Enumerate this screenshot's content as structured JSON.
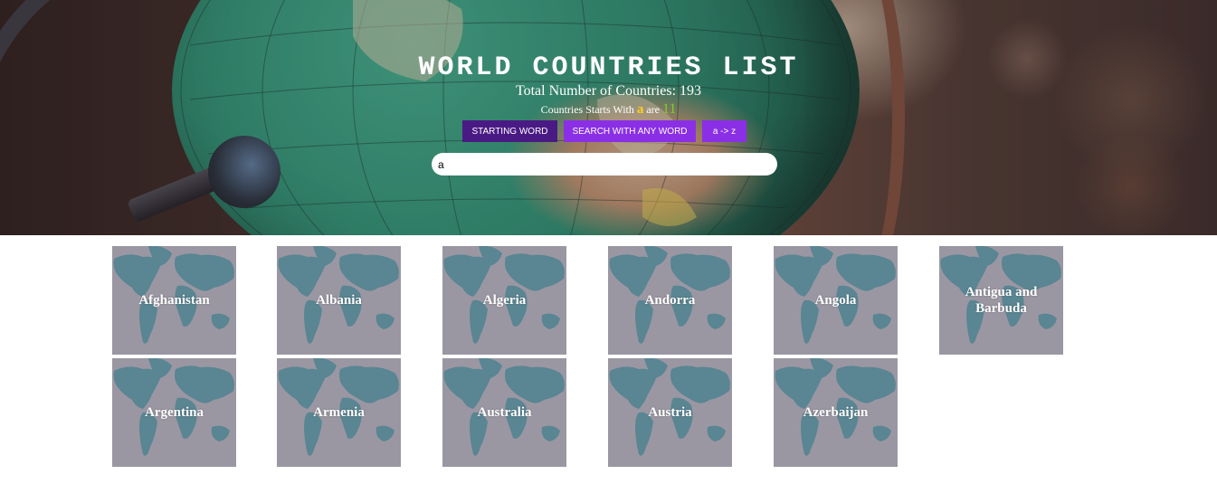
{
  "header": {
    "title": "WORLD COUNTRIES LIST",
    "total_prefix": "Total Number of Countries:",
    "total_count": "193",
    "starts_prefix": "Countries Starts With",
    "starts_letter": "a",
    "starts_are": "are",
    "starts_count": "11"
  },
  "buttons": {
    "starting_word": "STARTING WORD",
    "search_any": "SEARCH WITH ANY WORD",
    "sort": "a -> z"
  },
  "search": {
    "value": "a",
    "placeholder": ""
  },
  "countries": [
    "Afghanistan",
    "Albania",
    "Algeria",
    "Andorra",
    "Angola",
    "Antigua and Barbuda",
    "Argentina",
    "Armenia",
    "Australia",
    "Austria",
    "Azerbaijan"
  ],
  "colors": {
    "btn_dark": "#4a1a84",
    "btn_light": "#8b2fe6",
    "card_bg": "#9a97a3",
    "map_land": "#4f8390",
    "letter_highlight": "#ffd21a",
    "count_highlight": "#7ccf2a"
  }
}
